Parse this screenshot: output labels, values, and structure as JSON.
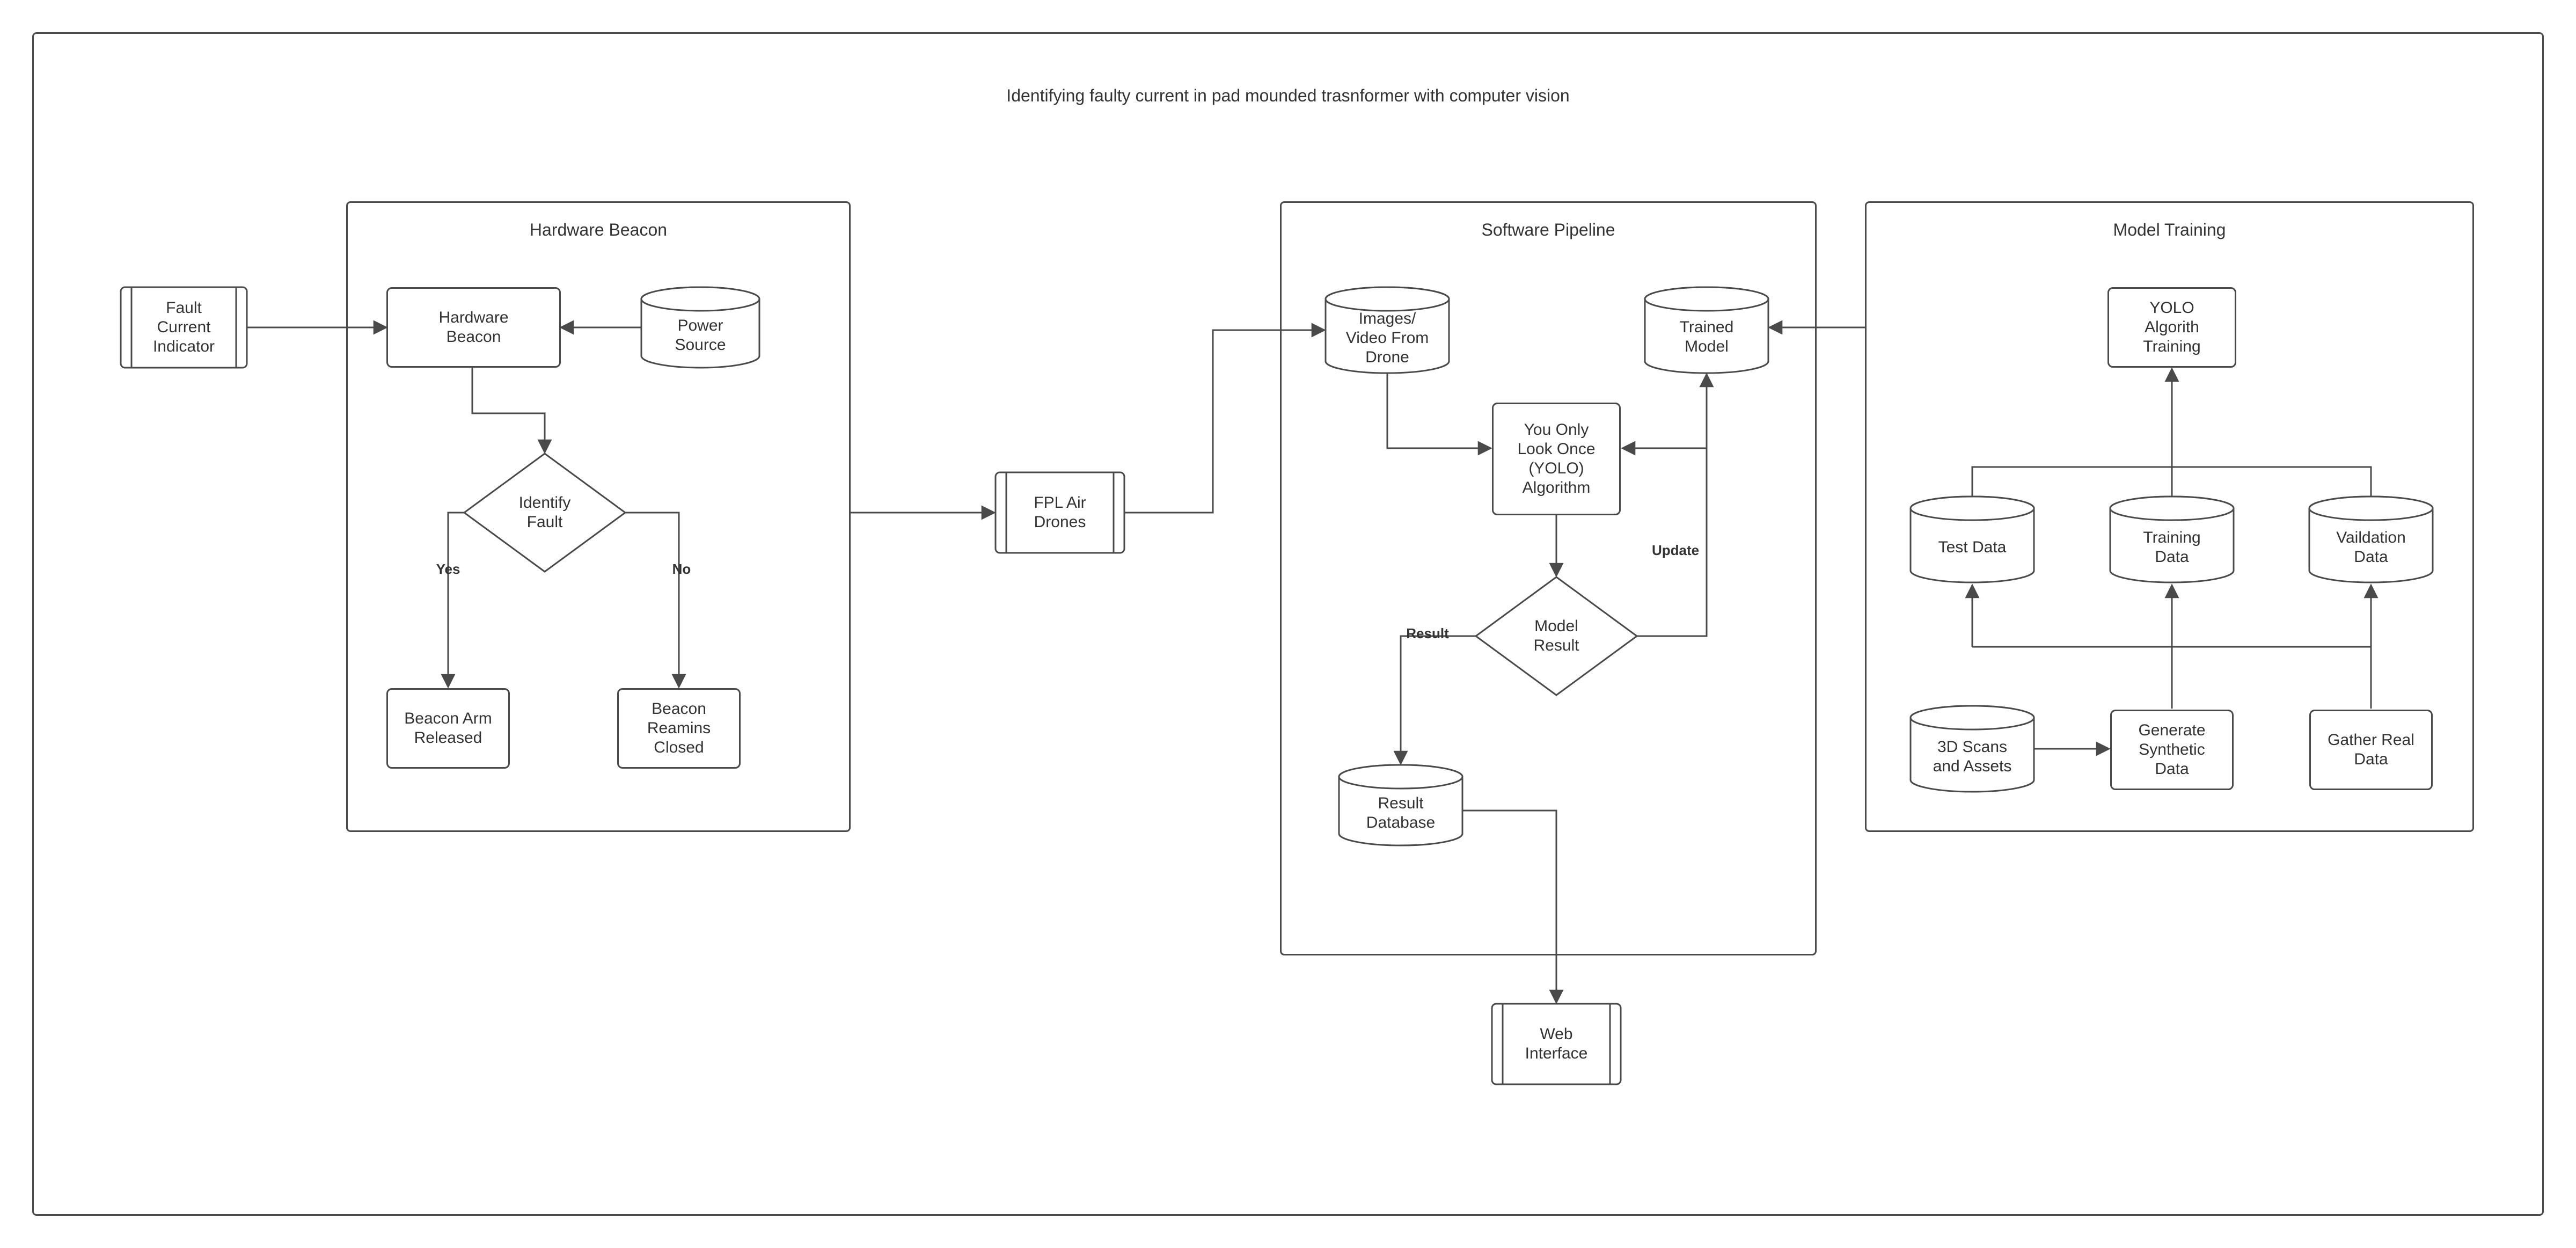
{
  "title": "Identifying faulty current in pad mounded trasnformer with computer vision",
  "groups": {
    "hardware": "Hardware Beacon",
    "software": "Software Pipeline",
    "training": "Model Training"
  },
  "nodes": {
    "fault_current_indicator": "Fault\nCurrent\nIndicator",
    "hardware_beacon": "Hardware\nBeacon",
    "power_source": "Power\nSource",
    "identify_fault": "Identify\nFault",
    "beacon_arm_released": "Beacon Arm\nReleased",
    "beacon_remains_closed": "Beacon\nReamins\nClosed",
    "fpl_air_drones": "FPL Air\nDrones",
    "images_video_from_drone": "Images/\nVideo From\nDrone",
    "trained_model": "Trained\nModel",
    "yolo_algorithm": "You Only\nLook Once\n(YOLO)\nAlgorithm",
    "model_result": "Model\nResult",
    "result_database": "Result\nDatabase",
    "web_interface": "Web\nInterface",
    "yolo_training": "YOLO\nAlgorith\nTraining",
    "test_data": "Test Data",
    "training_data": "Training\nData",
    "validation_data": "Vaildation\nData",
    "scans_assets": "3D Scans\nand Assets",
    "gen_synth": "Generate\nSynthetic\nData",
    "gather_real": "Gather Real\nData"
  },
  "edges": {
    "yes": "Yes",
    "no": "No",
    "result": "Result",
    "update": "Update"
  }
}
